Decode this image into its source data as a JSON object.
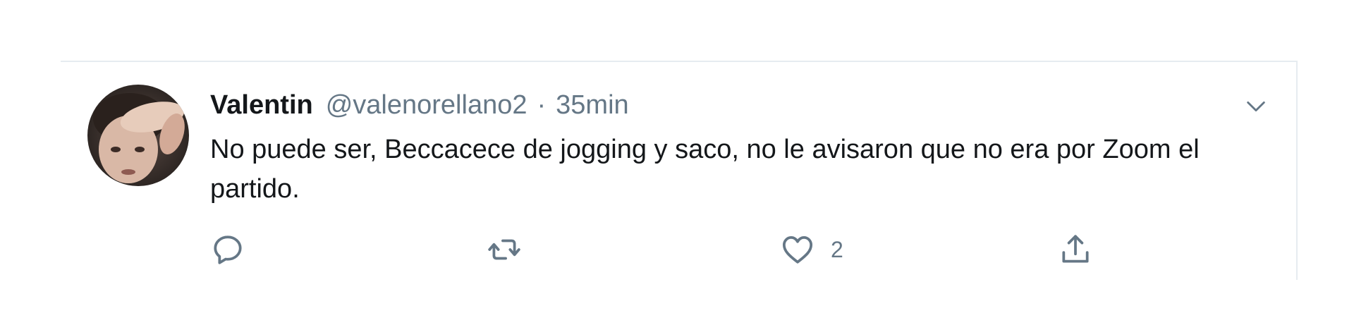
{
  "tweet": {
    "display_name": "Valentin",
    "handle": "@valenorellano2",
    "separator": "·",
    "time": "35min",
    "text": "No puede ser, Beccacece de jogging y saco, no le avisaron que no era por Zoom el partido.",
    "avatar_icon": "user-photo",
    "menu_icon": "chevron-down-icon"
  },
  "actions": {
    "reply": {
      "icon": "reply-icon",
      "count": ""
    },
    "retweet": {
      "icon": "retweet-icon",
      "count": ""
    },
    "like": {
      "icon": "heart-icon",
      "count": "2"
    },
    "share": {
      "icon": "share-icon",
      "count": ""
    }
  },
  "colors": {
    "text_primary": "#14171a",
    "text_secondary": "#657786",
    "icon": "#657786",
    "border": "#e6ecf0"
  }
}
